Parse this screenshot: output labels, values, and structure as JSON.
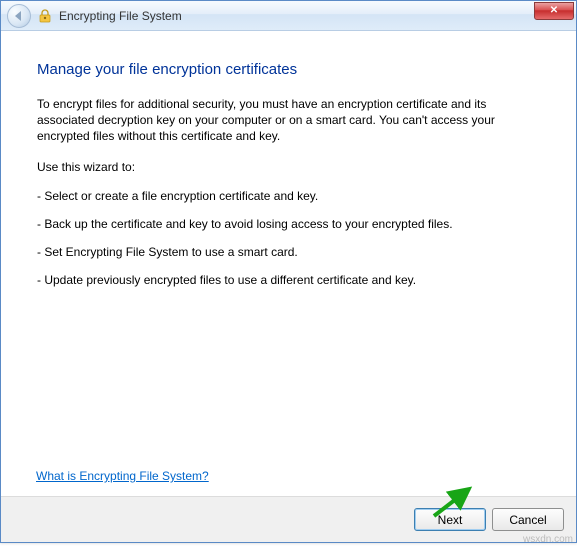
{
  "window": {
    "title": "Encrypting File System"
  },
  "content": {
    "heading": "Manage your file encryption certificates",
    "intro": "To encrypt files for additional security, you must have an encryption certificate and its associated decryption key on your computer or on a smart card. You can't access your encrypted files without this certificate and key.",
    "usage_label": "Use this wizard to:",
    "bullets": {
      "b1": "- Select or create a file encryption certificate and key.",
      "b2": "- Back up the certificate and key to avoid losing access to your encrypted files.",
      "b3": "- Set Encrypting File System to use a smart card.",
      "b4": "- Update previously encrypted files to use a different certificate and key."
    },
    "help_link": "What is Encrypting File System?"
  },
  "buttons": {
    "next": "Next",
    "cancel": "Cancel"
  },
  "watermark": "wsxdn.com"
}
